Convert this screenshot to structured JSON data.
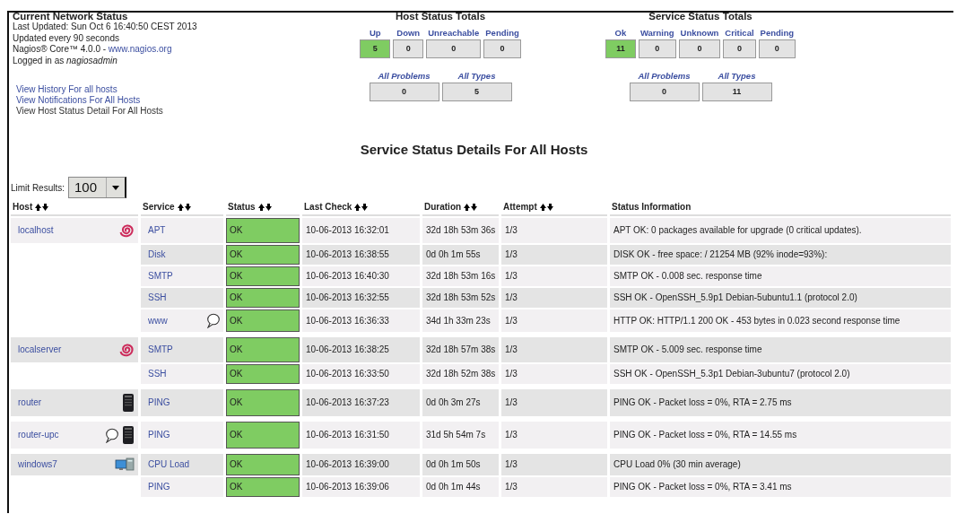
{
  "info": {
    "title": "Current Network Status",
    "last_updated": "Last Updated: Sun Oct 6 16:40:50 CEST 2013",
    "interval": "Updated every 90 seconds",
    "version": "Nagios® Core™ 4.0.0 - ",
    "version_link": "www.nagios.org",
    "logged_in": "Logged in as *nagiosadmin*",
    "links": [
      "View History For all hosts",
      "View Notifications For All Hosts",
      "View Host Status Detail For All Hosts"
    ]
  },
  "host_totals": {
    "title": "Host Status Totals",
    "items": [
      {
        "label": "Up",
        "value": "5",
        "color": "#7fcc62"
      },
      {
        "label": "Down",
        "value": "0",
        "color": "#e3e3e3"
      },
      {
        "label": "Unreachable",
        "value": "0",
        "color": "#e3e3e3"
      },
      {
        "label": "Pending",
        "value": "0",
        "color": "#e3e3e3"
      }
    ],
    "summary": [
      {
        "label": "All Problems",
        "value": "0"
      },
      {
        "label": "All Types",
        "value": "5"
      }
    ]
  },
  "service_totals": {
    "title": "Service Status Totals",
    "items": [
      {
        "label": "Ok",
        "value": "11",
        "color": "#7fcc62"
      },
      {
        "label": "Warning",
        "value": "0",
        "color": "#e3e3e3"
      },
      {
        "label": "Unknown",
        "value": "0",
        "color": "#e3e3e3"
      },
      {
        "label": "Critical",
        "value": "0",
        "color": "#e3e3e3"
      },
      {
        "label": "Pending",
        "value": "0",
        "color": "#e3e3e3"
      }
    ],
    "summary": [
      {
        "label": "All Problems",
        "value": "0"
      },
      {
        "label": "All Types",
        "value": "11"
      }
    ]
  },
  "page_title": "Service Status Details For All Hosts",
  "limit": {
    "label": "Limit Results:",
    "value": "100"
  },
  "table": {
    "columns": [
      {
        "label": "Host",
        "sortable": true
      },
      {
        "label": "Service",
        "sortable": true
      },
      {
        "label": "Status",
        "sortable": true
      },
      {
        "label": "Last Check",
        "sortable": true
      },
      {
        "label": "Duration",
        "sortable": true
      },
      {
        "label": "Attempt",
        "sortable": true
      },
      {
        "label": "Status Information",
        "sortable": false
      }
    ],
    "hosts": [
      {
        "name": "localhost",
        "kind": "spiral",
        "comment": false,
        "services": [
          {
            "name": "APT",
            "comment": false,
            "status": {
              "text": "OK",
              "color": "#7fcc62"
            },
            "last_check": "10-06-2013 16:32:01",
            "duration": "32d 18h 53m 36s",
            "attempt": "1/3",
            "info": "APT OK: 0 packages available for upgrade (0 critical updates)."
          },
          {
            "name": "Disk",
            "comment": false,
            "status": {
              "text": "OK",
              "color": "#7fcc62"
            },
            "last_check": "10-06-2013 16:38:55",
            "duration": "0d 0h 1m 55s",
            "attempt": "1/3",
            "info": "DISK OK - free space: / 21254 MB (92% inode=93%):"
          },
          {
            "name": "SMTP",
            "comment": false,
            "status": {
              "text": "OK",
              "color": "#7fcc62"
            },
            "last_check": "10-06-2013 16:40:30",
            "duration": "32d 18h 53m 16s",
            "attempt": "1/3",
            "info": "SMTP OK - 0.008 sec. response time"
          },
          {
            "name": "SSH",
            "comment": false,
            "status": {
              "text": "OK",
              "color": "#7fcc62"
            },
            "last_check": "10-06-2013 16:32:55",
            "duration": "32d 18h 53m 52s",
            "attempt": "1/3",
            "info": "SSH OK - OpenSSH_5.9p1 Debian-5ubuntu1.1 (protocol 2.0)"
          },
          {
            "name": "www",
            "comment": true,
            "status": {
              "text": "OK",
              "color": "#7fcc62"
            },
            "last_check": "10-06-2013 16:36:33",
            "duration": "34d 1h 33m 23s",
            "attempt": "1/3",
            "info": "HTTP OK: HTTP/1.1 200 OK - 453 bytes in 0.023 second response time"
          }
        ]
      },
      {
        "name": "localserver",
        "kind": "spiral",
        "comment": false,
        "services": [
          {
            "name": "SMTP",
            "comment": false,
            "status": {
              "text": "OK",
              "color": "#7fcc62"
            },
            "last_check": "10-06-2013 16:38:25",
            "duration": "32d 18h 57m 38s",
            "attempt": "1/3",
            "info": "SMTP OK - 5.009 sec. response time"
          },
          {
            "name": "SSH",
            "comment": false,
            "status": {
              "text": "OK",
              "color": "#7fcc62"
            },
            "last_check": "10-06-2013 16:33:50",
            "duration": "32d 18h 52m 38s",
            "attempt": "1/3",
            "info": "SSH OK - OpenSSH_5.3p1 Debian-3ubuntu7 (protocol 2.0)"
          }
        ]
      },
      {
        "name": "router",
        "kind": "server",
        "comment": false,
        "services": [
          {
            "name": "PING",
            "comment": false,
            "status": {
              "text": "OK",
              "color": "#7fcc62"
            },
            "last_check": "10-06-2013 16:37:23",
            "duration": "0d 0h 3m 27s",
            "attempt": "1/3",
            "info": "PING OK - Packet loss = 0%, RTA = 2.75 ms"
          }
        ]
      },
      {
        "name": "router-upc",
        "kind": "server",
        "comment": true,
        "services": [
          {
            "name": "PING",
            "comment": false,
            "status": {
              "text": "OK",
              "color": "#7fcc62"
            },
            "last_check": "10-06-2013 16:31:50",
            "duration": "31d 5h 54m 7s",
            "attempt": "1/3",
            "info": "PING OK - Packet loss = 0%, RTA = 14.55 ms"
          }
        ]
      },
      {
        "name": "windows7",
        "kind": "computer",
        "comment": false,
        "services": [
          {
            "name": "CPU Load",
            "comment": false,
            "status": {
              "text": "OK",
              "color": "#7fcc62"
            },
            "last_check": "10-06-2013 16:39:00",
            "duration": "0d 0h 1m 50s",
            "attempt": "1/3",
            "info": "CPU Load 0% (30 min average)"
          },
          {
            "name": "PING",
            "comment": false,
            "status": {
              "text": "OK",
              "color": "#7fcc62"
            },
            "last_check": "10-06-2013 16:39:06",
            "duration": "0d 0h 1m 44s",
            "attempt": "1/3",
            "info": "PING OK - Packet loss = 0%, RTA = 3.41 ms"
          }
        ]
      }
    ]
  }
}
